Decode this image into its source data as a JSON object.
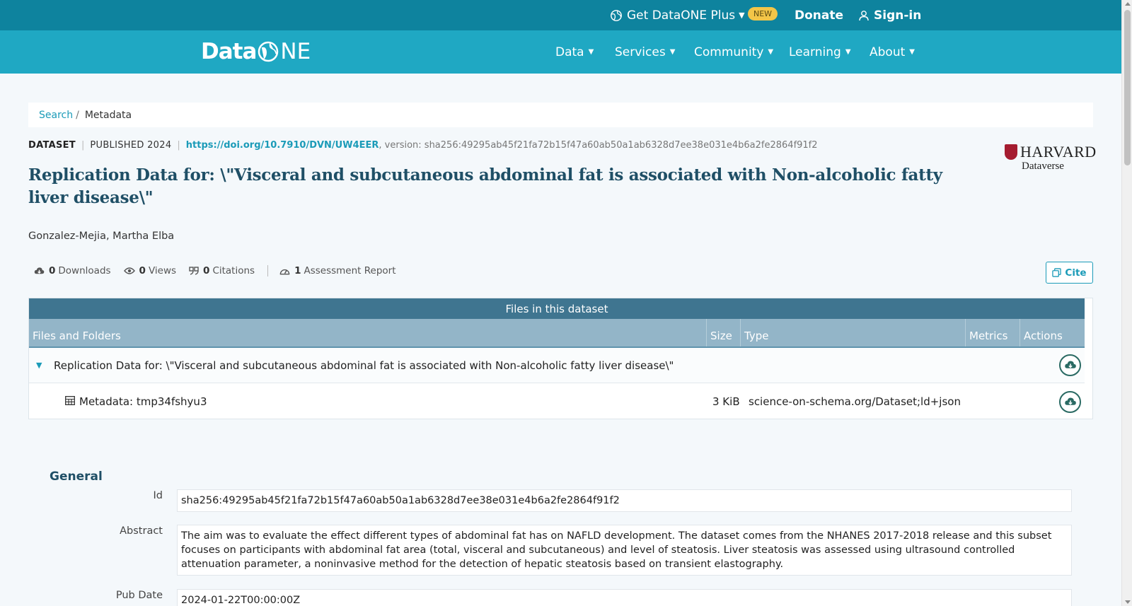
{
  "topbar": {
    "plus_label": "Get DataONE Plus",
    "new_badge": "NEW",
    "donate": "Donate",
    "signin": "Sign-in"
  },
  "nav": {
    "logo_left": "Data",
    "logo_right": "NE",
    "items": [
      "Data",
      "Services",
      "Community",
      "Learning",
      "About"
    ]
  },
  "breadcrumb": {
    "search": "Search",
    "separator": "/",
    "current": "Metadata"
  },
  "dataset": {
    "type": "DATASET",
    "published": "PUBLISHED 2024",
    "doi": "https://doi.org/10.7910/DVN/UW4EER",
    "version": ", version: sha256:49295ab45f21fa72b15f47a60ab50a1ab6328d7ee38e031e4b6a2fe2864f91f2",
    "title": "Replication Data for: \\\"Visceral and subcutaneous abdominal fat is associated with Non-alcoholic fatty liver disease\\\"",
    "author": "Gonzalez-Mejia, Martha Elba",
    "repository": {
      "name": "HARVARD",
      "sub": "Dataverse"
    }
  },
  "metrics": {
    "downloads_count": "0",
    "downloads_label": "Downloads",
    "views_count": "0",
    "views_label": "Views",
    "citations_count": "0",
    "citations_label": "Citations",
    "assessment_count": "1",
    "assessment_label": "Assessment Report",
    "cite_button": "Cite"
  },
  "files_table": {
    "caption": "Files in this dataset",
    "columns": [
      "Files and Folders",
      "Size",
      "Type",
      "Metrics",
      "Actions"
    ],
    "folder": {
      "name": "Replication Data for: \\\"Visceral and subcutaneous abdominal fat is associated with Non-alcoholic fatty liver disease\\\""
    },
    "rows": [
      {
        "name": "Metadata: tmp34fshyu3",
        "size": "3 KiB",
        "type": "science-on-schema.org/Dataset;ld+json"
      }
    ]
  },
  "general": {
    "heading": "General",
    "fields": [
      {
        "label": "Id",
        "value": "sha256:49295ab45f21fa72b15f47a60ab50a1ab6328d7ee38e031e4b6a2fe2864f91f2"
      },
      {
        "label": "Abstract",
        "value": "The aim was to evaluate the effect different types of abdominal fat has on NAFLD development. The dataset comes from the NHANES 2017-2018 release and this subset focuses on participants with abdominal fat area (total, visceral and subcutaneous) and level of steatosis. Liver steatosis was assessed using ultrasound controlled attenuation parameter, a noninvasive method for the detection of hepatic steatosis based on transient elastography."
      },
      {
        "label": "Pub Date",
        "value": "2024-01-22T00:00:00Z"
      }
    ]
  },
  "colors": {
    "topbar": "#0e839e",
    "navbar": "#1fa8c3",
    "accent": "#1b9bb8",
    "title": "#1f4f66",
    "table_caption": "#3f7590",
    "table_header": "#93b5c8",
    "badge": "#f3c548"
  },
  "icons": [
    "globe-icon",
    "chevron-down-icon",
    "user-icon",
    "cloud-download-icon",
    "eye-icon",
    "quote-icon",
    "gauge-icon",
    "copy-icon",
    "caret-down-icon",
    "table-icon"
  ]
}
